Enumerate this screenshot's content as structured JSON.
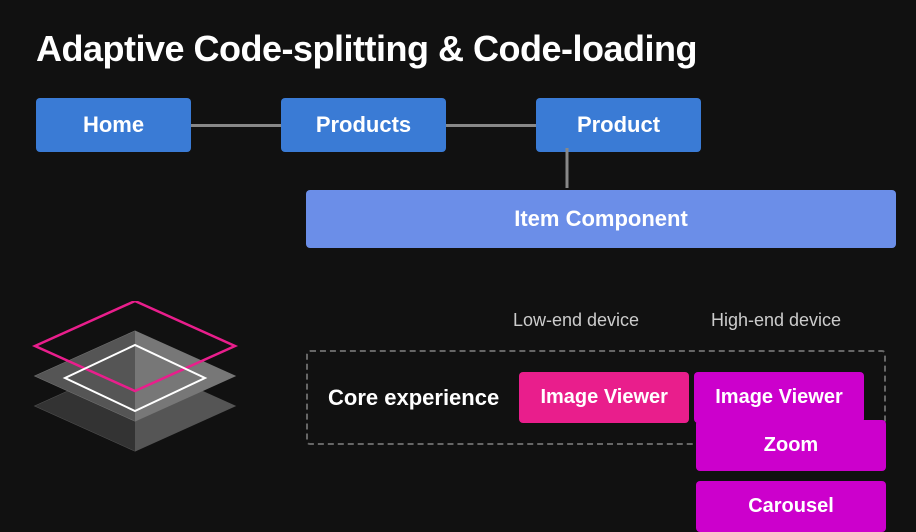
{
  "page": {
    "title": "Adaptive Code-splitting & Code-loading",
    "nodes": {
      "home": "Home",
      "products": "Products",
      "product": "Product",
      "item_component": "Item Component"
    },
    "labels": {
      "low_end": "Low-end device",
      "high_end": "High-end device",
      "core_experience": "Core experience",
      "image_viewer": "Image Viewer",
      "zoom": "Zoom",
      "carousel": "Carousel"
    },
    "colors": {
      "bg": "#111111",
      "node_blue": "#3a7bd5",
      "node_light_blue": "#6b8ee8",
      "pink": "#e91e8c",
      "magenta": "#cc00cc",
      "connector": "#888888",
      "dashed_border": "#666666"
    }
  }
}
